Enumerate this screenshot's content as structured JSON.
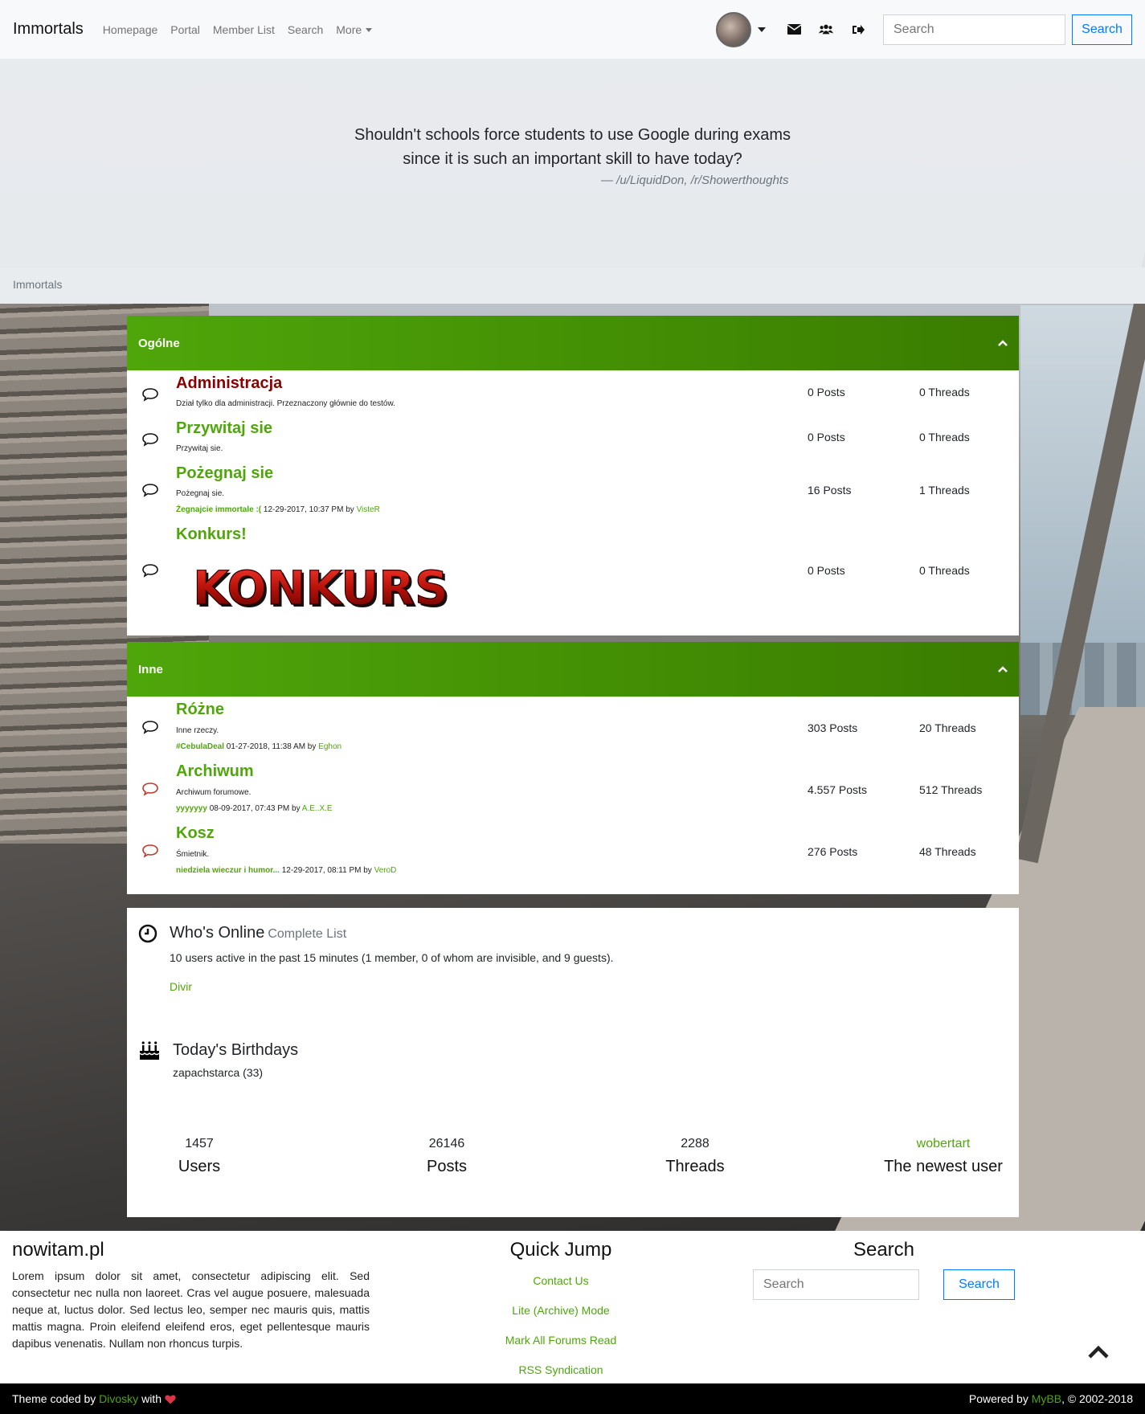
{
  "navbar": {
    "brand": "Immortals",
    "links": [
      "Homepage",
      "Portal",
      "Member List",
      "Search",
      "More"
    ],
    "search_placeholder": "Search",
    "search_button": "Search"
  },
  "hero": {
    "quote_line1": "Shouldn't schools force students to use Google during exams",
    "quote_line2": "since it is such an important skill to have today?",
    "source": "— /u/LiquidDon, /r/Showerthoughts"
  },
  "breadcrumb": "Immortals",
  "categories": [
    {
      "name": "Ogólne",
      "forums": [
        {
          "title": "Administracja",
          "desc": "Dział tylko dla administracji. Przeznaczony głównie do testów.",
          "posts": "0 Posts",
          "threads": "0 Threads"
        },
        {
          "title": "Przywitaj sie",
          "desc": "Przywitaj sie.",
          "posts": "0 Posts",
          "threads": "0 Threads"
        },
        {
          "title": "Pożegnaj sie",
          "desc": "Pożegnaj sie.",
          "last_thread": "Żegnajcie immortale :(",
          "last_date": " 12-29-2017, 10:37 PM by ",
          "last_user": "VisteR",
          "posts": "16 Posts",
          "threads": "1 Threads"
        },
        {
          "title": "Konkurs!",
          "image_text": "KONKURS",
          "posts": "0 Posts",
          "threads": "0 Threads"
        }
      ]
    },
    {
      "name": "Inne",
      "forums": [
        {
          "title": "Różne",
          "desc": "Inne rzeczy.",
          "last_thread": "#CebulaDeal",
          "last_date": " 01-27-2018, 11:38 AM by ",
          "last_user": "Eghon",
          "posts": "303 Posts",
          "threads": "20 Threads"
        },
        {
          "title": "Archiwum",
          "desc": "Archiwum forumowe.",
          "last_thread": "yyyyyyy",
          "last_date": " 08-09-2017, 07:43 PM by ",
          "last_user": "A.E..X.E",
          "posts": "4.557 Posts",
          "threads": "512 Threads"
        },
        {
          "title": "Kosz",
          "desc": "Śmietnik.",
          "last_thread": "niedziela wieczur i humor...",
          "last_date": " 12-29-2017, 08:11 PM by ",
          "last_user": "VeroD",
          "posts": "276 Posts",
          "threads": "48 Threads"
        }
      ]
    }
  ],
  "whos_online": {
    "title": "Who's Online",
    "complete_list": "Complete List",
    "text": "10 users active in the past 15 minutes (1 member, 0 of whom are invisible, and 9 guests).",
    "member": "Divir"
  },
  "birthdays": {
    "title": "Today's Birthdays",
    "text": "zapachstarca (33)"
  },
  "stats": [
    {
      "value": "1457",
      "label": "Users"
    },
    {
      "value": "26146",
      "label": "Posts"
    },
    {
      "value": "2288",
      "label": "Threads"
    },
    {
      "value": "wobertart",
      "label": "The newest user"
    }
  ],
  "footer": {
    "title": "nowitam.pl",
    "text": "Lorem ipsum dolor sit amet, consectetur adipiscing elit. Sed consectetur nec nulla non laoreet. Cras vel augue posuere, malesuada neque at, luctus dolor. Sed lectus leo, semper nec mauris quis, mattis mattis magna. Proin eleifend eleifend eros, eget pellentesque mauris dapibus venenatis. Nullam non rhoncus turpis.",
    "quick_jump_title": "Quick Jump",
    "quick_links": [
      "Contact Us",
      "Lite (Archive) Mode",
      "Mark All Forums Read",
      "RSS Syndication"
    ],
    "search_title": "Search",
    "search_placeholder": "Search",
    "search_button": "Search"
  },
  "bottom_bar": {
    "left_prefix": "Theme coded by ",
    "left_author": "Divosky",
    "left_suffix": " with ",
    "right_prefix": "Powered by ",
    "right_link": "MyBB",
    "right_suffix": ", © 2002-2018"
  },
  "colors": {
    "accent": "#4fa60a",
    "admin_title": "#8b0000",
    "link_blue": "#007bff",
    "heart": "#dc3545"
  }
}
